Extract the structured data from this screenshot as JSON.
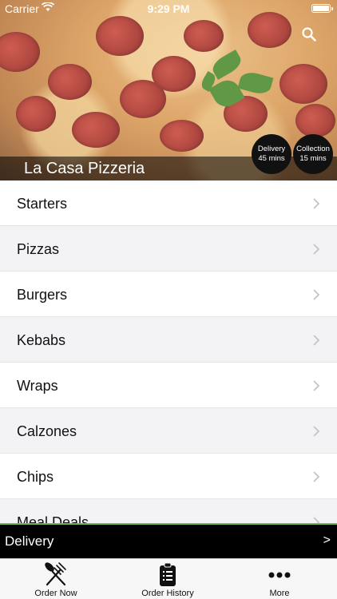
{
  "status_bar": {
    "carrier": "Carrier",
    "time": "9:29 PM"
  },
  "hero": {
    "restaurant_name": "La Casa Pizzeria",
    "delivery": {
      "label": "Delivery",
      "time": "45 mins"
    },
    "collection": {
      "label": "Collection",
      "time": "15 mins"
    },
    "search_icon": "search-icon"
  },
  "menu": {
    "items": [
      {
        "label": "Starters"
      },
      {
        "label": "Pizzas"
      },
      {
        "label": "Burgers"
      },
      {
        "label": "Kebabs"
      },
      {
        "label": "Wraps"
      },
      {
        "label": "Calzones"
      },
      {
        "label": "Chips"
      },
      {
        "label": "Meal Deals"
      }
    ]
  },
  "order_bar": {
    "label": "Delivery",
    "arrow": ">"
  },
  "tabbar": {
    "tabs": [
      {
        "label": "Order Now",
        "icon": "fork-knife-icon"
      },
      {
        "label": "Order History",
        "icon": "clipboard-icon"
      },
      {
        "label": "More",
        "icon": "more-dots-icon"
      }
    ]
  },
  "colors": {
    "accent_green": "#6fb552",
    "bar_black": "#000000"
  }
}
